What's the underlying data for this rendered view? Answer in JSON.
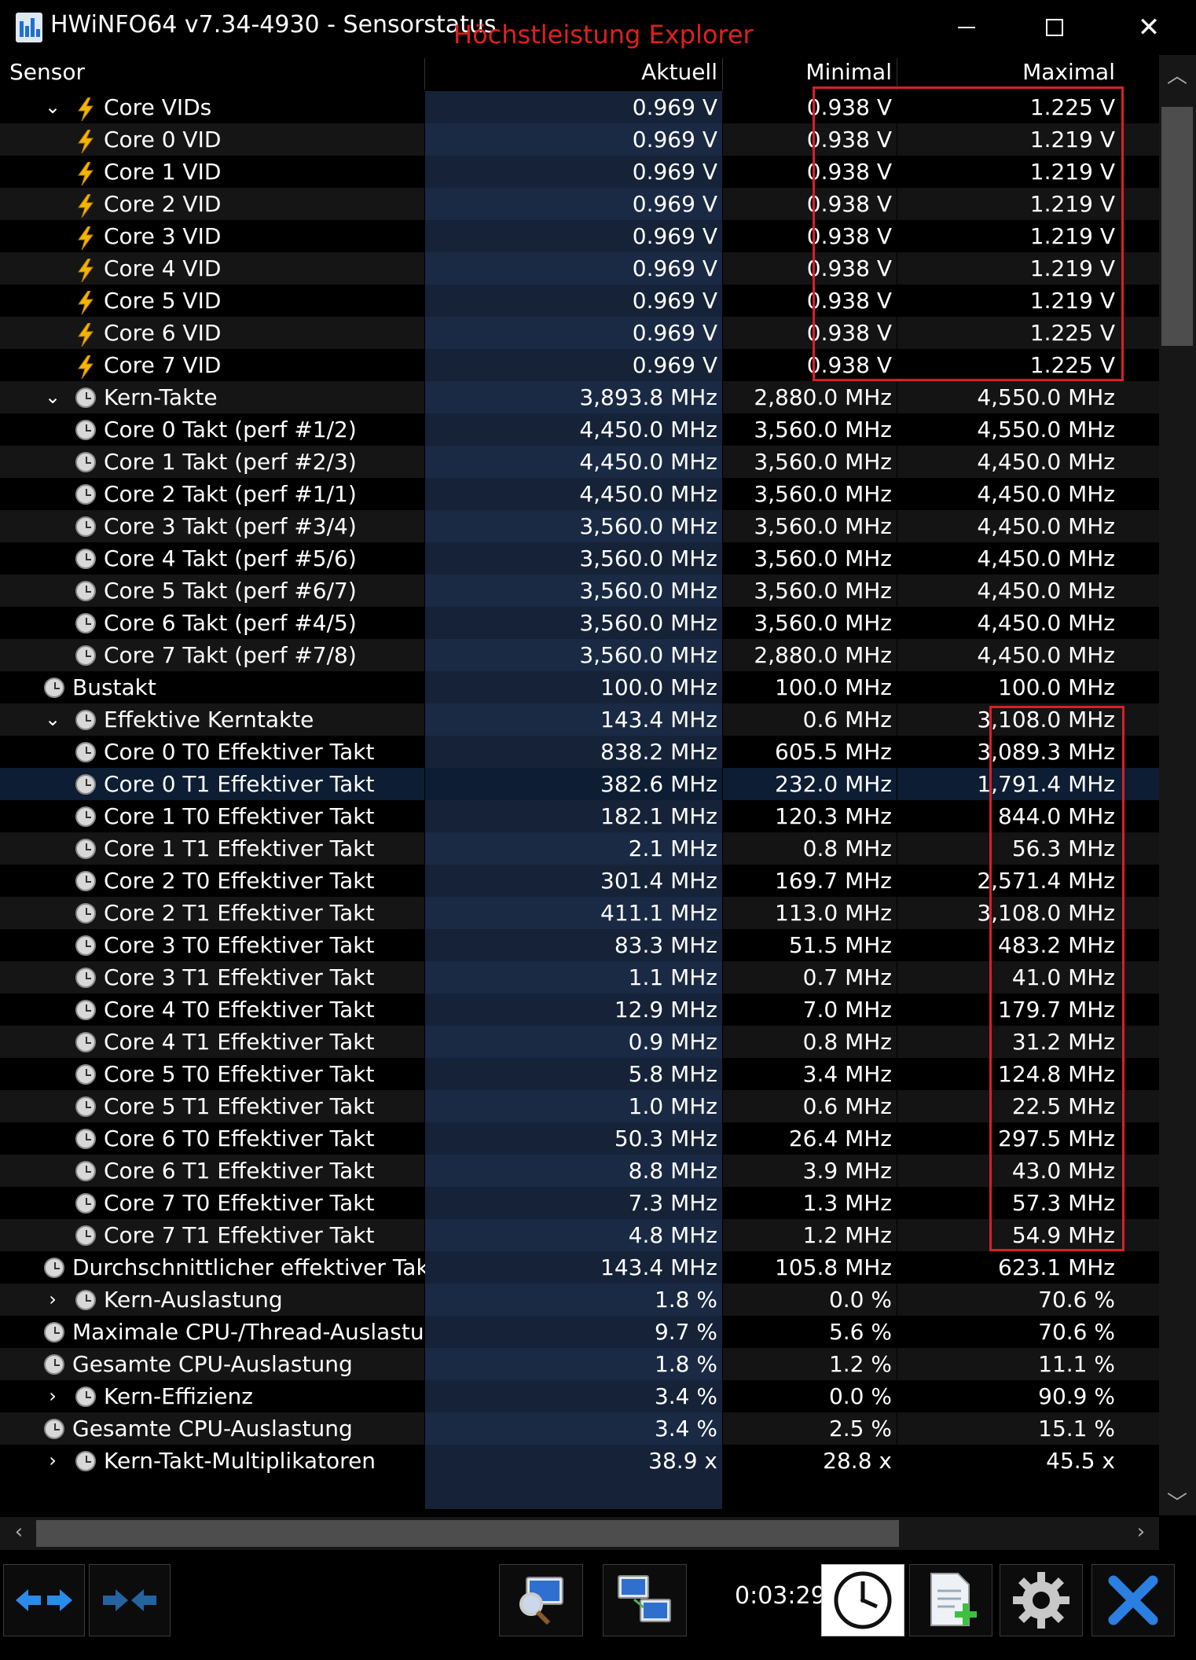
{
  "window": {
    "title": "HWiNFO64 v7.34-4930 - Sensorstatus",
    "annotation": "Höchstleistung Explorer"
  },
  "header": {
    "sensor": "Sensor",
    "aktuell": "Aktuell",
    "minimal": "Minimal",
    "maximal": "Maximal"
  },
  "rows": [
    {
      "label": "Core VIDs",
      "icon": "voltage-bolt-icon",
      "indent": 1,
      "expander": "collapse",
      "cur": "0.969 V",
      "min": "0.938 V",
      "max": "1.225 V"
    },
    {
      "label": "Core 0 VID",
      "icon": "voltage-bolt-icon",
      "indent": 2,
      "expander": "",
      "cur": "0.969 V",
      "min": "0.938 V",
      "max": "1.219 V"
    },
    {
      "label": "Core 1 VID",
      "icon": "voltage-bolt-icon",
      "indent": 2,
      "expander": "",
      "cur": "0.969 V",
      "min": "0.938 V",
      "max": "1.219 V"
    },
    {
      "label": "Core 2 VID",
      "icon": "voltage-bolt-icon",
      "indent": 2,
      "expander": "",
      "cur": "0.969 V",
      "min": "0.938 V",
      "max": "1.219 V"
    },
    {
      "label": "Core 3 VID",
      "icon": "voltage-bolt-icon",
      "indent": 2,
      "expander": "",
      "cur": "0.969 V",
      "min": "0.938 V",
      "max": "1.219 V"
    },
    {
      "label": "Core 4 VID",
      "icon": "voltage-bolt-icon",
      "indent": 2,
      "expander": "",
      "cur": "0.969 V",
      "min": "0.938 V",
      "max": "1.219 V"
    },
    {
      "label": "Core 5 VID",
      "icon": "voltage-bolt-icon",
      "indent": 2,
      "expander": "",
      "cur": "0.969 V",
      "min": "0.938 V",
      "max": "1.219 V"
    },
    {
      "label": "Core 6 VID",
      "icon": "voltage-bolt-icon",
      "indent": 2,
      "expander": "",
      "cur": "0.969 V",
      "min": "0.938 V",
      "max": "1.225 V"
    },
    {
      "label": "Core 7 VID",
      "icon": "voltage-bolt-icon",
      "indent": 2,
      "expander": "",
      "cur": "0.969 V",
      "min": "0.938 V",
      "max": "1.225 V"
    },
    {
      "label": "Kern-Takte",
      "icon": "clock-icon",
      "indent": 1,
      "expander": "collapse",
      "cur": "3,893.8 MHz",
      "min": "2,880.0 MHz",
      "max": "4,550.0 MHz"
    },
    {
      "label": "Core 0 Takt (perf #1/2)",
      "icon": "clock-icon",
      "indent": 2,
      "expander": "",
      "cur": "4,450.0 MHz",
      "min": "3,560.0 MHz",
      "max": "4,550.0 MHz"
    },
    {
      "label": "Core 1 Takt (perf #2/3)",
      "icon": "clock-icon",
      "indent": 2,
      "expander": "",
      "cur": "4,450.0 MHz",
      "min": "3,560.0 MHz",
      "max": "4,450.0 MHz"
    },
    {
      "label": "Core 2 Takt (perf #1/1)",
      "icon": "clock-icon",
      "indent": 2,
      "expander": "",
      "cur": "4,450.0 MHz",
      "min": "3,560.0 MHz",
      "max": "4,450.0 MHz"
    },
    {
      "label": "Core 3 Takt (perf #3/4)",
      "icon": "clock-icon",
      "indent": 2,
      "expander": "",
      "cur": "3,560.0 MHz",
      "min": "3,560.0 MHz",
      "max": "4,450.0 MHz"
    },
    {
      "label": "Core 4 Takt (perf #5/6)",
      "icon": "clock-icon",
      "indent": 2,
      "expander": "",
      "cur": "3,560.0 MHz",
      "min": "3,560.0 MHz",
      "max": "4,450.0 MHz"
    },
    {
      "label": "Core 5 Takt (perf #6/7)",
      "icon": "clock-icon",
      "indent": 2,
      "expander": "",
      "cur": "3,560.0 MHz",
      "min": "3,560.0 MHz",
      "max": "4,450.0 MHz"
    },
    {
      "label": "Core 6 Takt (perf #4/5)",
      "icon": "clock-icon",
      "indent": 2,
      "expander": "",
      "cur": "3,560.0 MHz",
      "min": "3,560.0 MHz",
      "max": "4,450.0 MHz"
    },
    {
      "label": "Core 7 Takt (perf #7/8)",
      "icon": "clock-icon",
      "indent": 2,
      "expander": "",
      "cur": "3,560.0 MHz",
      "min": "2,880.0 MHz",
      "max": "4,450.0 MHz"
    },
    {
      "label": "Bustakt",
      "icon": "clock-icon",
      "indent": 0,
      "expander": "",
      "cur": "100.0 MHz",
      "min": "100.0 MHz",
      "max": "100.0 MHz"
    },
    {
      "label": "Effektive Kerntakte",
      "icon": "clock-icon",
      "indent": 1,
      "expander": "collapse",
      "cur": "143.4 MHz",
      "min": "0.6 MHz",
      "max": "3,108.0 MHz"
    },
    {
      "label": "Core 0 T0 Effektiver Takt",
      "icon": "clock-icon",
      "indent": 2,
      "expander": "",
      "cur": "838.2 MHz",
      "min": "605.5 MHz",
      "max": "3,089.3 MHz"
    },
    {
      "label": "Core 0 T1 Effektiver Takt",
      "icon": "clock-icon",
      "indent": 2,
      "expander": "",
      "cur": "382.6 MHz",
      "min": "232.0 MHz",
      "max": "1,791.4 MHz",
      "selected": true
    },
    {
      "label": "Core 1 T0 Effektiver Takt",
      "icon": "clock-icon",
      "indent": 2,
      "expander": "",
      "cur": "182.1 MHz",
      "min": "120.3 MHz",
      "max": "844.0 MHz"
    },
    {
      "label": "Core 1 T1 Effektiver Takt",
      "icon": "clock-icon",
      "indent": 2,
      "expander": "",
      "cur": "2.1 MHz",
      "min": "0.8 MHz",
      "max": "56.3 MHz"
    },
    {
      "label": "Core 2 T0 Effektiver Takt",
      "icon": "clock-icon",
      "indent": 2,
      "expander": "",
      "cur": "301.4 MHz",
      "min": "169.7 MHz",
      "max": "2,571.4 MHz"
    },
    {
      "label": "Core 2 T1 Effektiver Takt",
      "icon": "clock-icon",
      "indent": 2,
      "expander": "",
      "cur": "411.1 MHz",
      "min": "113.0 MHz",
      "max": "3,108.0 MHz"
    },
    {
      "label": "Core 3 T0 Effektiver Takt",
      "icon": "clock-icon",
      "indent": 2,
      "expander": "",
      "cur": "83.3 MHz",
      "min": "51.5 MHz",
      "max": "483.2 MHz"
    },
    {
      "label": "Core 3 T1 Effektiver Takt",
      "icon": "clock-icon",
      "indent": 2,
      "expander": "",
      "cur": "1.1 MHz",
      "min": "0.7 MHz",
      "max": "41.0 MHz"
    },
    {
      "label": "Core 4 T0 Effektiver Takt",
      "icon": "clock-icon",
      "indent": 2,
      "expander": "",
      "cur": "12.9 MHz",
      "min": "7.0 MHz",
      "max": "179.7 MHz"
    },
    {
      "label": "Core 4 T1 Effektiver Takt",
      "icon": "clock-icon",
      "indent": 2,
      "expander": "",
      "cur": "0.9 MHz",
      "min": "0.8 MHz",
      "max": "31.2 MHz"
    },
    {
      "label": "Core 5 T0 Effektiver Takt",
      "icon": "clock-icon",
      "indent": 2,
      "expander": "",
      "cur": "5.8 MHz",
      "min": "3.4 MHz",
      "max": "124.8 MHz"
    },
    {
      "label": "Core 5 T1 Effektiver Takt",
      "icon": "clock-icon",
      "indent": 2,
      "expander": "",
      "cur": "1.0 MHz",
      "min": "0.6 MHz",
      "max": "22.5 MHz"
    },
    {
      "label": "Core 6 T0 Effektiver Takt",
      "icon": "clock-icon",
      "indent": 2,
      "expander": "",
      "cur": "50.3 MHz",
      "min": "26.4 MHz",
      "max": "297.5 MHz"
    },
    {
      "label": "Core 6 T1 Effektiver Takt",
      "icon": "clock-icon",
      "indent": 2,
      "expander": "",
      "cur": "8.8 MHz",
      "min": "3.9 MHz",
      "max": "43.0 MHz"
    },
    {
      "label": "Core 7 T0 Effektiver Takt",
      "icon": "clock-icon",
      "indent": 2,
      "expander": "",
      "cur": "7.3 MHz",
      "min": "1.3 MHz",
      "max": "57.3 MHz"
    },
    {
      "label": "Core 7 T1 Effektiver Takt",
      "icon": "clock-icon",
      "indent": 2,
      "expander": "",
      "cur": "4.8 MHz",
      "min": "1.2 MHz",
      "max": "54.9 MHz"
    },
    {
      "label": "Durchschnittlicher effektiver Takt",
      "icon": "clock-icon",
      "indent": 0,
      "expander": "",
      "cur": "143.4 MHz",
      "min": "105.8 MHz",
      "max": "623.1 MHz"
    },
    {
      "label": "Kern-Auslastung",
      "icon": "clock-icon",
      "indent": 1,
      "expander": "expand",
      "cur": "1.8 %",
      "min": "0.0 %",
      "max": "70.6 %"
    },
    {
      "label": "Maximale CPU-/Thread-Auslastung",
      "icon": "clock-icon",
      "indent": 0,
      "expander": "",
      "cur": "9.7 %",
      "min": "5.6 %",
      "max": "70.6 %"
    },
    {
      "label": "Gesamte CPU-Auslastung",
      "icon": "clock-icon",
      "indent": 0,
      "expander": "",
      "cur": "1.8 %",
      "min": "1.2 %",
      "max": "11.1 %"
    },
    {
      "label": "Kern-Effizienz",
      "icon": "clock-icon",
      "indent": 1,
      "expander": "expand",
      "cur": "3.4 %",
      "min": "0.0 %",
      "max": "90.9 %"
    },
    {
      "label": "Gesamte CPU-Auslastung",
      "icon": "clock-icon",
      "indent": 0,
      "expander": "",
      "cur": "3.4 %",
      "min": "2.5 %",
      "max": "15.1 %"
    },
    {
      "label": "Kern-Takt-Multiplikatoren",
      "icon": "clock-icon",
      "indent": 1,
      "expander": "expand",
      "cur": "38.9 x",
      "min": "28.8 x",
      "max": "45.5 x"
    }
  ],
  "toolbar": {
    "timer": "0:03:29",
    "buttons": [
      "expand-collapse-arrows-icon",
      "collapse-arrows-icon",
      "sensor-search-icon",
      "network-computers-icon",
      "clock-reset-icon",
      "report-add-icon",
      "settings-gear-icon",
      "close-x-icon"
    ]
  },
  "colors": {
    "background": "#000000",
    "aktuell_column": "#152238",
    "selected_row": "#0d1d33",
    "annotation_red": "#e0201e",
    "close_blue": "#2a7fe0"
  }
}
